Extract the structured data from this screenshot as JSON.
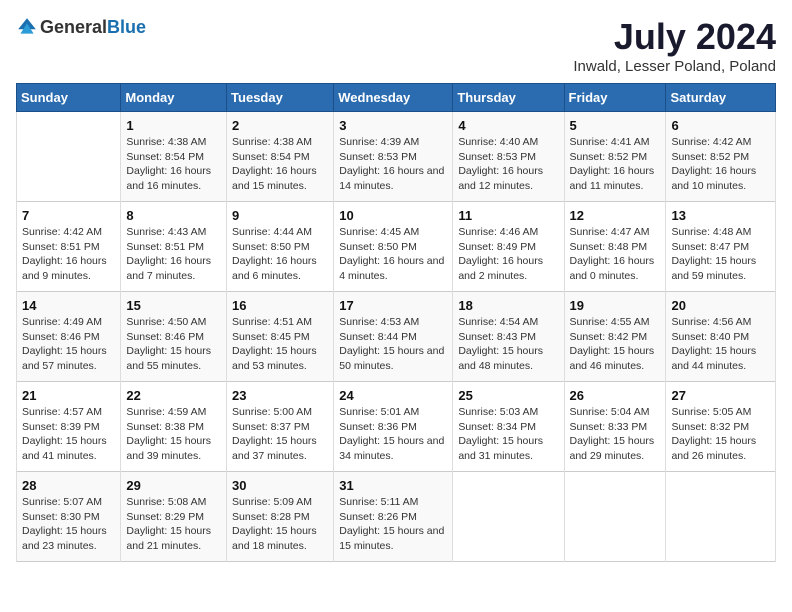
{
  "header": {
    "logo_general": "General",
    "logo_blue": "Blue",
    "month_year": "July 2024",
    "location": "Inwald, Lesser Poland, Poland"
  },
  "weekdays": [
    "Sunday",
    "Monday",
    "Tuesday",
    "Wednesday",
    "Thursday",
    "Friday",
    "Saturday"
  ],
  "weeks": [
    [
      {
        "day": "",
        "sunrise": "",
        "sunset": "",
        "daylight": ""
      },
      {
        "day": "1",
        "sunrise": "Sunrise: 4:38 AM",
        "sunset": "Sunset: 8:54 PM",
        "daylight": "Daylight: 16 hours and 16 minutes."
      },
      {
        "day": "2",
        "sunrise": "Sunrise: 4:38 AM",
        "sunset": "Sunset: 8:54 PM",
        "daylight": "Daylight: 16 hours and 15 minutes."
      },
      {
        "day": "3",
        "sunrise": "Sunrise: 4:39 AM",
        "sunset": "Sunset: 8:53 PM",
        "daylight": "Daylight: 16 hours and 14 minutes."
      },
      {
        "day": "4",
        "sunrise": "Sunrise: 4:40 AM",
        "sunset": "Sunset: 8:53 PM",
        "daylight": "Daylight: 16 hours and 12 minutes."
      },
      {
        "day": "5",
        "sunrise": "Sunrise: 4:41 AM",
        "sunset": "Sunset: 8:52 PM",
        "daylight": "Daylight: 16 hours and 11 minutes."
      },
      {
        "day": "6",
        "sunrise": "Sunrise: 4:42 AM",
        "sunset": "Sunset: 8:52 PM",
        "daylight": "Daylight: 16 hours and 10 minutes."
      }
    ],
    [
      {
        "day": "7",
        "sunrise": "Sunrise: 4:42 AM",
        "sunset": "Sunset: 8:51 PM",
        "daylight": "Daylight: 16 hours and 9 minutes."
      },
      {
        "day": "8",
        "sunrise": "Sunrise: 4:43 AM",
        "sunset": "Sunset: 8:51 PM",
        "daylight": "Daylight: 16 hours and 7 minutes."
      },
      {
        "day": "9",
        "sunrise": "Sunrise: 4:44 AM",
        "sunset": "Sunset: 8:50 PM",
        "daylight": "Daylight: 16 hours and 6 minutes."
      },
      {
        "day": "10",
        "sunrise": "Sunrise: 4:45 AM",
        "sunset": "Sunset: 8:50 PM",
        "daylight": "Daylight: 16 hours and 4 minutes."
      },
      {
        "day": "11",
        "sunrise": "Sunrise: 4:46 AM",
        "sunset": "Sunset: 8:49 PM",
        "daylight": "Daylight: 16 hours and 2 minutes."
      },
      {
        "day": "12",
        "sunrise": "Sunrise: 4:47 AM",
        "sunset": "Sunset: 8:48 PM",
        "daylight": "Daylight: 16 hours and 0 minutes."
      },
      {
        "day": "13",
        "sunrise": "Sunrise: 4:48 AM",
        "sunset": "Sunset: 8:47 PM",
        "daylight": "Daylight: 15 hours and 59 minutes."
      }
    ],
    [
      {
        "day": "14",
        "sunrise": "Sunrise: 4:49 AM",
        "sunset": "Sunset: 8:46 PM",
        "daylight": "Daylight: 15 hours and 57 minutes."
      },
      {
        "day": "15",
        "sunrise": "Sunrise: 4:50 AM",
        "sunset": "Sunset: 8:46 PM",
        "daylight": "Daylight: 15 hours and 55 minutes."
      },
      {
        "day": "16",
        "sunrise": "Sunrise: 4:51 AM",
        "sunset": "Sunset: 8:45 PM",
        "daylight": "Daylight: 15 hours and 53 minutes."
      },
      {
        "day": "17",
        "sunrise": "Sunrise: 4:53 AM",
        "sunset": "Sunset: 8:44 PM",
        "daylight": "Daylight: 15 hours and 50 minutes."
      },
      {
        "day": "18",
        "sunrise": "Sunrise: 4:54 AM",
        "sunset": "Sunset: 8:43 PM",
        "daylight": "Daylight: 15 hours and 48 minutes."
      },
      {
        "day": "19",
        "sunrise": "Sunrise: 4:55 AM",
        "sunset": "Sunset: 8:42 PM",
        "daylight": "Daylight: 15 hours and 46 minutes."
      },
      {
        "day": "20",
        "sunrise": "Sunrise: 4:56 AM",
        "sunset": "Sunset: 8:40 PM",
        "daylight": "Daylight: 15 hours and 44 minutes."
      }
    ],
    [
      {
        "day": "21",
        "sunrise": "Sunrise: 4:57 AM",
        "sunset": "Sunset: 8:39 PM",
        "daylight": "Daylight: 15 hours and 41 minutes."
      },
      {
        "day": "22",
        "sunrise": "Sunrise: 4:59 AM",
        "sunset": "Sunset: 8:38 PM",
        "daylight": "Daylight: 15 hours and 39 minutes."
      },
      {
        "day": "23",
        "sunrise": "Sunrise: 5:00 AM",
        "sunset": "Sunset: 8:37 PM",
        "daylight": "Daylight: 15 hours and 37 minutes."
      },
      {
        "day": "24",
        "sunrise": "Sunrise: 5:01 AM",
        "sunset": "Sunset: 8:36 PM",
        "daylight": "Daylight: 15 hours and 34 minutes."
      },
      {
        "day": "25",
        "sunrise": "Sunrise: 5:03 AM",
        "sunset": "Sunset: 8:34 PM",
        "daylight": "Daylight: 15 hours and 31 minutes."
      },
      {
        "day": "26",
        "sunrise": "Sunrise: 5:04 AM",
        "sunset": "Sunset: 8:33 PM",
        "daylight": "Daylight: 15 hours and 29 minutes."
      },
      {
        "day": "27",
        "sunrise": "Sunrise: 5:05 AM",
        "sunset": "Sunset: 8:32 PM",
        "daylight": "Daylight: 15 hours and 26 minutes."
      }
    ],
    [
      {
        "day": "28",
        "sunrise": "Sunrise: 5:07 AM",
        "sunset": "Sunset: 8:30 PM",
        "daylight": "Daylight: 15 hours and 23 minutes."
      },
      {
        "day": "29",
        "sunrise": "Sunrise: 5:08 AM",
        "sunset": "Sunset: 8:29 PM",
        "daylight": "Daylight: 15 hours and 21 minutes."
      },
      {
        "day": "30",
        "sunrise": "Sunrise: 5:09 AM",
        "sunset": "Sunset: 8:28 PM",
        "daylight": "Daylight: 15 hours and 18 minutes."
      },
      {
        "day": "31",
        "sunrise": "Sunrise: 5:11 AM",
        "sunset": "Sunset: 8:26 PM",
        "daylight": "Daylight: 15 hours and 15 minutes."
      },
      {
        "day": "",
        "sunrise": "",
        "sunset": "",
        "daylight": ""
      },
      {
        "day": "",
        "sunrise": "",
        "sunset": "",
        "daylight": ""
      },
      {
        "day": "",
        "sunrise": "",
        "sunset": "",
        "daylight": ""
      }
    ]
  ]
}
